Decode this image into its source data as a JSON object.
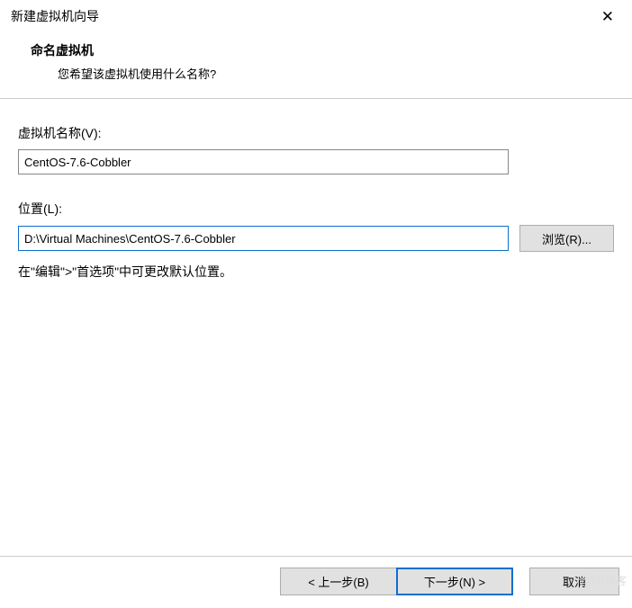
{
  "titlebar": {
    "title": "新建虚拟机向导"
  },
  "header": {
    "title": "命名虚拟机",
    "subtitle": "您希望该虚拟机使用什么名称?"
  },
  "fields": {
    "name_label": "虚拟机名称(V):",
    "name_value": "CentOS-7.6-Cobbler",
    "location_label": "位置(L):",
    "location_value": "D:\\Virtual Machines\\CentOS-7.6-Cobbler",
    "browse_label": "浏览(R)...",
    "hint": "在\"编辑\">\"首选项\"中可更改默认位置。"
  },
  "footer": {
    "back_label": "< 上一步(B)",
    "next_label": "下一步(N) >",
    "cancel_label": "取消"
  },
  "watermark": "@TO博客"
}
